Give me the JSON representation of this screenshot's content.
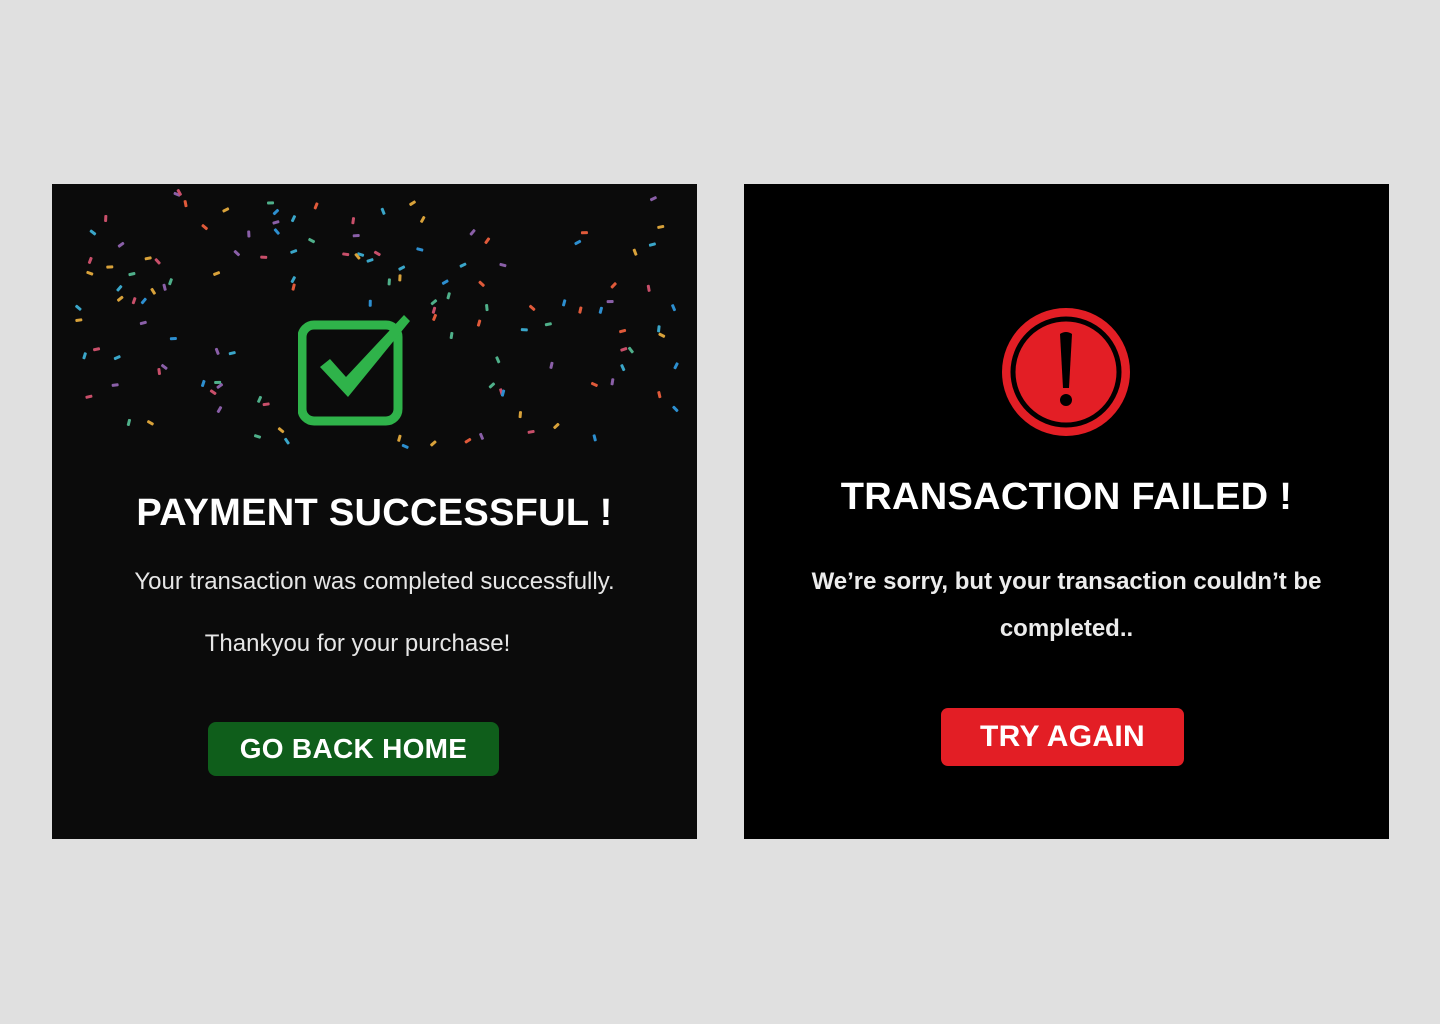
{
  "success_card": {
    "title": "PAYMENT SUCCESSFUL !",
    "message_line1": "Your transaction was completed successfully.",
    "message_line2": "Thankyou for your purchase!",
    "button_label": "GO BACK HOME",
    "icon": "checkbox-check-icon",
    "accent_color": "#2fb34a",
    "button_color": "#0f5e1b",
    "decoration": "confetti"
  },
  "failed_card": {
    "title": "TRANSACTION FAILED !",
    "message": "We’re sorry, but your transaction couldn’t be completed..",
    "button_label": "TRY AGAIN",
    "icon": "exclamation-circle-icon",
    "accent_color": "#e31e25",
    "button_color": "#e31e25"
  }
}
